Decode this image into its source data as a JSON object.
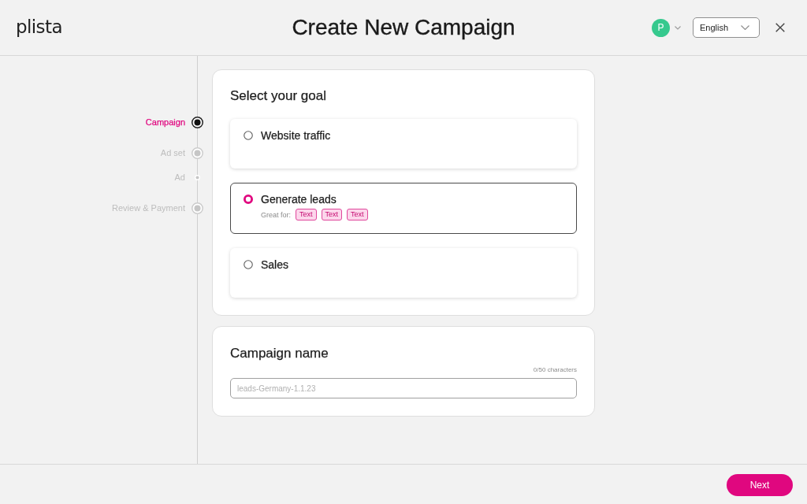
{
  "header": {
    "logo": "plista",
    "title": "Create New Campaign",
    "avatar": "P",
    "language": "English"
  },
  "steps": [
    {
      "label": "Campaign",
      "kind": "step",
      "selected": true
    },
    {
      "label": "Ad set",
      "kind": "step",
      "selected": false
    },
    {
      "label": "Ad",
      "kind": "substep",
      "selected": false
    },
    {
      "label": "Review & Payment",
      "kind": "step",
      "selected": false
    }
  ],
  "goal_card": {
    "title": "Select your goal",
    "options": [
      {
        "label": "Website traffic",
        "selected": false
      },
      {
        "label": "Generate leads",
        "selected": true,
        "hint": "Great for:",
        "tags": [
          "Text",
          "Text",
          "Text"
        ]
      },
      {
        "label": "Sales",
        "selected": false
      }
    ]
  },
  "name_card": {
    "title": "Campaign name",
    "counter": "0/50 characters",
    "placeholder": "leads-Germany-1.1.23"
  },
  "footer": {
    "next_button": "Next"
  }
}
